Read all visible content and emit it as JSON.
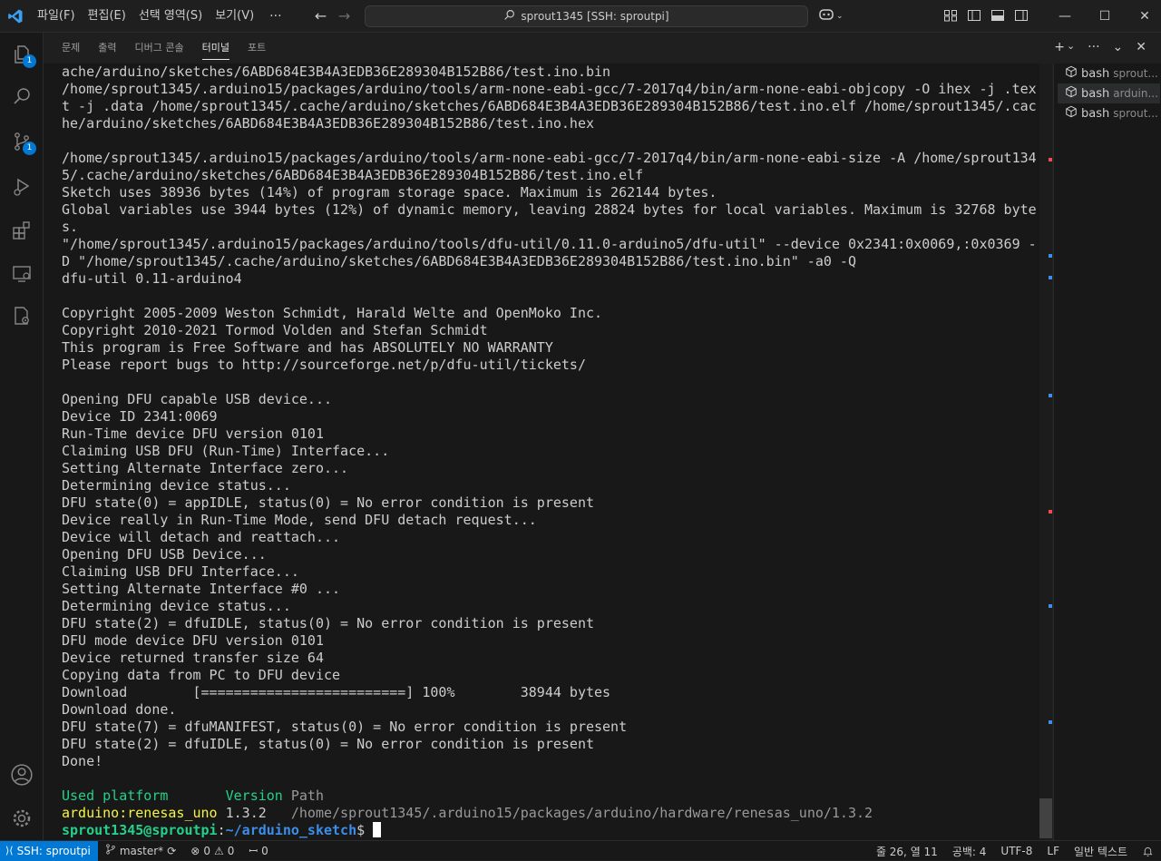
{
  "menu": {
    "file": "파일(F)",
    "edit": "편집(E)",
    "selection": "선택 영역(S)",
    "view": "보기(V)",
    "more": "···"
  },
  "command_center": {
    "text": "sprout1345 [SSH: sproutpi]"
  },
  "activity": {
    "explorer_badge": "1",
    "scm_badge": "1"
  },
  "panel_tabs": [
    "문제",
    "출력",
    "디버그 콘솔",
    "터미널",
    "포트"
  ],
  "terminal_tabs": [
    {
      "name": "bash",
      "sub": "sprout..."
    },
    {
      "name": "bash",
      "sub": "arduin..."
    },
    {
      "name": "bash",
      "sub": "sprout..."
    }
  ],
  "terminal": {
    "lines": [
      "ache/arduino/sketches/6ABD684E3B4A3EDB36E289304B152B86/test.ino.bin",
      "/home/sprout1345/.arduino15/packages/arduino/tools/arm-none-eabi-gcc/7-2017q4/bin/arm-none-eabi-objcopy -O ihex -j .tex",
      "t -j .data /home/sprout1345/.cache/arduino/sketches/6ABD684E3B4A3EDB36E289304B152B86/test.ino.elf /home/sprout1345/.cac",
      "he/arduino/sketches/6ABD684E3B4A3EDB36E289304B152B86/test.ino.hex",
      "",
      "/home/sprout1345/.arduino15/packages/arduino/tools/arm-none-eabi-gcc/7-2017q4/bin/arm-none-eabi-size -A /home/sprout134",
      "5/.cache/arduino/sketches/6ABD684E3B4A3EDB36E289304B152B86/test.ino.elf",
      "Sketch uses 38936 bytes (14%) of program storage space. Maximum is 262144 bytes.",
      "Global variables use 3944 bytes (12%) of dynamic memory, leaving 28824 bytes for local variables. Maximum is 32768 byte",
      "s.",
      "\"/home/sprout1345/.arduino15/packages/arduino/tools/dfu-util/0.11.0-arduino5/dfu-util\" --device 0x2341:0x0069,:0x0369 -",
      "D \"/home/sprout1345/.cache/arduino/sketches/6ABD684E3B4A3EDB36E289304B152B86/test.ino.bin\" -a0 -Q",
      "dfu-util 0.11-arduino4",
      "",
      "Copyright 2005-2009 Weston Schmidt, Harald Welte and OpenMoko Inc.",
      "Copyright 2010-2021 Tormod Volden and Stefan Schmidt",
      "This program is Free Software and has ABSOLUTELY NO WARRANTY",
      "Please report bugs to http://sourceforge.net/p/dfu-util/tickets/",
      "",
      "Opening DFU capable USB device...",
      "Device ID 2341:0069",
      "Run-Time device DFU version 0101",
      "Claiming USB DFU (Run-Time) Interface...",
      "Setting Alternate Interface zero...",
      "Determining device status...",
      "DFU state(0) = appIDLE, status(0) = No error condition is present",
      "Device really in Run-Time Mode, send DFU detach request...",
      "Device will detach and reattach...",
      "Opening DFU USB Device...",
      "Claiming USB DFU Interface...",
      "Setting Alternate Interface #0 ...",
      "Determining device status...",
      "DFU state(2) = dfuIDLE, status(0) = No error condition is present",
      "DFU mode device DFU version 0101",
      "Device returned transfer size 64",
      "Copying data from PC to DFU device",
      "Download        [=========================] 100%        38944 bytes",
      "Download done.",
      "DFU state(7) = dfuMANIFEST, status(0) = No error condition is present",
      "DFU state(2) = dfuIDLE, status(0) = No error condition is present",
      "Done!",
      ""
    ],
    "platform_header": {
      "col1": "Used platform",
      "col2": "Version",
      "col3": "Path"
    },
    "platform_row": {
      "name": "arduino:renesas_uno",
      "version": "1.3.2",
      "path": "/home/sprout1345/.arduino15/packages/arduino/hardware/renesas_uno/1.3.2"
    },
    "prompt": {
      "user_host": "sprout1345@sproutpi",
      "sep": ":",
      "path": "~/arduino_sketch",
      "symbol": "$"
    }
  },
  "statusbar": {
    "remote": "SSH: sproutpi",
    "branch": "master*",
    "errors": "0",
    "warnings": "0",
    "ports": "0",
    "position": "줄 26, 열 11",
    "spaces": "공백: 4",
    "encoding": "UTF-8",
    "eol": "LF",
    "language": "일반 텍스트"
  },
  "colors": {
    "accent": "#0078d4",
    "green": "#23d18b",
    "yellow": "#f5f543",
    "blue": "#3b8eea"
  }
}
